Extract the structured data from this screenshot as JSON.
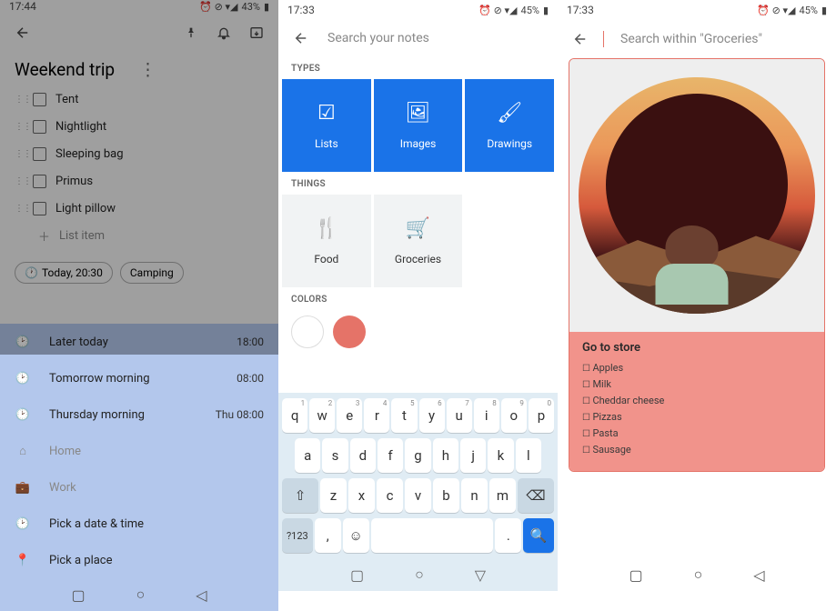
{
  "panel1": {
    "status": {
      "time": "17:44",
      "battery": "43%"
    },
    "note": {
      "title": "Weekend trip",
      "items": [
        "Tent",
        "Nightlight",
        "Sleeping bag",
        "Primus",
        "Light pillow"
      ],
      "add_placeholder": "List item",
      "reminder_chip": "Today, 20:30",
      "tag_chip": "Camping"
    },
    "reminder_options": [
      {
        "icon": "clock",
        "label": "Later today",
        "time": "18:00",
        "enabled": true
      },
      {
        "icon": "clock",
        "label": "Tomorrow morning",
        "time": "08:00",
        "enabled": true
      },
      {
        "icon": "clock",
        "label": "Thursday morning",
        "time": "Thu 08:00",
        "enabled": true
      },
      {
        "icon": "home",
        "label": "Home",
        "time": "",
        "enabled": false
      },
      {
        "icon": "briefcase",
        "label": "Work",
        "time": "",
        "enabled": false
      },
      {
        "icon": "clock",
        "label": "Pick a date & time",
        "time": "",
        "enabled": true
      },
      {
        "icon": "pin",
        "label": "Pick a place",
        "time": "",
        "enabled": true
      }
    ]
  },
  "panel2": {
    "status": {
      "time": "17:33",
      "battery": "45%"
    },
    "search_placeholder": "Search your notes",
    "sections": {
      "types_label": "TYPES",
      "things_label": "THINGS",
      "colors_label": "COLORS",
      "types": [
        {
          "icon": "checkbox",
          "label": "Lists"
        },
        {
          "icon": "image",
          "label": "Images"
        },
        {
          "icon": "brush",
          "label": "Drawings"
        }
      ],
      "things": [
        {
          "icon": "food",
          "label": "Food"
        },
        {
          "icon": "cart",
          "label": "Groceries"
        }
      ],
      "colors": [
        "#ffffff",
        "#e57368"
      ]
    },
    "keyboard": {
      "row1": [
        "q",
        "w",
        "e",
        "r",
        "t",
        "y",
        "u",
        "i",
        "o",
        "p"
      ],
      "row1_nums": [
        "1",
        "2",
        "3",
        "4",
        "5",
        "6",
        "7",
        "8",
        "9",
        "0"
      ],
      "row2": [
        "a",
        "s",
        "d",
        "f",
        "g",
        "h",
        "j",
        "k",
        "l"
      ],
      "row3": [
        "z",
        "x",
        "c",
        "v",
        "b",
        "n",
        "m"
      ],
      "sym": "?123"
    }
  },
  "panel3": {
    "status": {
      "time": "17:33",
      "battery": "45%"
    },
    "search_placeholder": "Search within \"Groceries\"",
    "note": {
      "title": "Go to store",
      "items": [
        "Apples",
        "Milk",
        "Cheddar cheese",
        "Pizzas",
        "Pasta",
        "Sausage"
      ]
    }
  }
}
